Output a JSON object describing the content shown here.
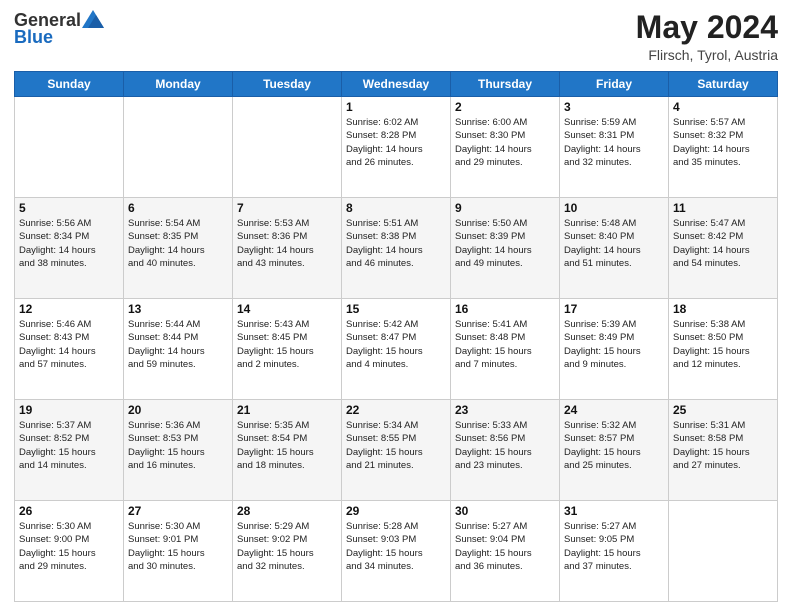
{
  "header": {
    "logo_general": "General",
    "logo_blue": "Blue",
    "title": "May 2024",
    "location": "Flirsch, Tyrol, Austria"
  },
  "days_of_week": [
    "Sunday",
    "Monday",
    "Tuesday",
    "Wednesday",
    "Thursday",
    "Friday",
    "Saturday"
  ],
  "weeks": [
    [
      {
        "day": "",
        "info": ""
      },
      {
        "day": "",
        "info": ""
      },
      {
        "day": "",
        "info": ""
      },
      {
        "day": "1",
        "info": "Sunrise: 6:02 AM\nSunset: 8:28 PM\nDaylight: 14 hours\nand 26 minutes."
      },
      {
        "day": "2",
        "info": "Sunrise: 6:00 AM\nSunset: 8:30 PM\nDaylight: 14 hours\nand 29 minutes."
      },
      {
        "day": "3",
        "info": "Sunrise: 5:59 AM\nSunset: 8:31 PM\nDaylight: 14 hours\nand 32 minutes."
      },
      {
        "day": "4",
        "info": "Sunrise: 5:57 AM\nSunset: 8:32 PM\nDaylight: 14 hours\nand 35 minutes."
      }
    ],
    [
      {
        "day": "5",
        "info": "Sunrise: 5:56 AM\nSunset: 8:34 PM\nDaylight: 14 hours\nand 38 minutes."
      },
      {
        "day": "6",
        "info": "Sunrise: 5:54 AM\nSunset: 8:35 PM\nDaylight: 14 hours\nand 40 minutes."
      },
      {
        "day": "7",
        "info": "Sunrise: 5:53 AM\nSunset: 8:36 PM\nDaylight: 14 hours\nand 43 minutes."
      },
      {
        "day": "8",
        "info": "Sunrise: 5:51 AM\nSunset: 8:38 PM\nDaylight: 14 hours\nand 46 minutes."
      },
      {
        "day": "9",
        "info": "Sunrise: 5:50 AM\nSunset: 8:39 PM\nDaylight: 14 hours\nand 49 minutes."
      },
      {
        "day": "10",
        "info": "Sunrise: 5:48 AM\nSunset: 8:40 PM\nDaylight: 14 hours\nand 51 minutes."
      },
      {
        "day": "11",
        "info": "Sunrise: 5:47 AM\nSunset: 8:42 PM\nDaylight: 14 hours\nand 54 minutes."
      }
    ],
    [
      {
        "day": "12",
        "info": "Sunrise: 5:46 AM\nSunset: 8:43 PM\nDaylight: 14 hours\nand 57 minutes."
      },
      {
        "day": "13",
        "info": "Sunrise: 5:44 AM\nSunset: 8:44 PM\nDaylight: 14 hours\nand 59 minutes."
      },
      {
        "day": "14",
        "info": "Sunrise: 5:43 AM\nSunset: 8:45 PM\nDaylight: 15 hours\nand 2 minutes."
      },
      {
        "day": "15",
        "info": "Sunrise: 5:42 AM\nSunset: 8:47 PM\nDaylight: 15 hours\nand 4 minutes."
      },
      {
        "day": "16",
        "info": "Sunrise: 5:41 AM\nSunset: 8:48 PM\nDaylight: 15 hours\nand 7 minutes."
      },
      {
        "day": "17",
        "info": "Sunrise: 5:39 AM\nSunset: 8:49 PM\nDaylight: 15 hours\nand 9 minutes."
      },
      {
        "day": "18",
        "info": "Sunrise: 5:38 AM\nSunset: 8:50 PM\nDaylight: 15 hours\nand 12 minutes."
      }
    ],
    [
      {
        "day": "19",
        "info": "Sunrise: 5:37 AM\nSunset: 8:52 PM\nDaylight: 15 hours\nand 14 minutes."
      },
      {
        "day": "20",
        "info": "Sunrise: 5:36 AM\nSunset: 8:53 PM\nDaylight: 15 hours\nand 16 minutes."
      },
      {
        "day": "21",
        "info": "Sunrise: 5:35 AM\nSunset: 8:54 PM\nDaylight: 15 hours\nand 18 minutes."
      },
      {
        "day": "22",
        "info": "Sunrise: 5:34 AM\nSunset: 8:55 PM\nDaylight: 15 hours\nand 21 minutes."
      },
      {
        "day": "23",
        "info": "Sunrise: 5:33 AM\nSunset: 8:56 PM\nDaylight: 15 hours\nand 23 minutes."
      },
      {
        "day": "24",
        "info": "Sunrise: 5:32 AM\nSunset: 8:57 PM\nDaylight: 15 hours\nand 25 minutes."
      },
      {
        "day": "25",
        "info": "Sunrise: 5:31 AM\nSunset: 8:58 PM\nDaylight: 15 hours\nand 27 minutes."
      }
    ],
    [
      {
        "day": "26",
        "info": "Sunrise: 5:30 AM\nSunset: 9:00 PM\nDaylight: 15 hours\nand 29 minutes."
      },
      {
        "day": "27",
        "info": "Sunrise: 5:30 AM\nSunset: 9:01 PM\nDaylight: 15 hours\nand 30 minutes."
      },
      {
        "day": "28",
        "info": "Sunrise: 5:29 AM\nSunset: 9:02 PM\nDaylight: 15 hours\nand 32 minutes."
      },
      {
        "day": "29",
        "info": "Sunrise: 5:28 AM\nSunset: 9:03 PM\nDaylight: 15 hours\nand 34 minutes."
      },
      {
        "day": "30",
        "info": "Sunrise: 5:27 AM\nSunset: 9:04 PM\nDaylight: 15 hours\nand 36 minutes."
      },
      {
        "day": "31",
        "info": "Sunrise: 5:27 AM\nSunset: 9:05 PM\nDaylight: 15 hours\nand 37 minutes."
      },
      {
        "day": "",
        "info": ""
      }
    ]
  ]
}
